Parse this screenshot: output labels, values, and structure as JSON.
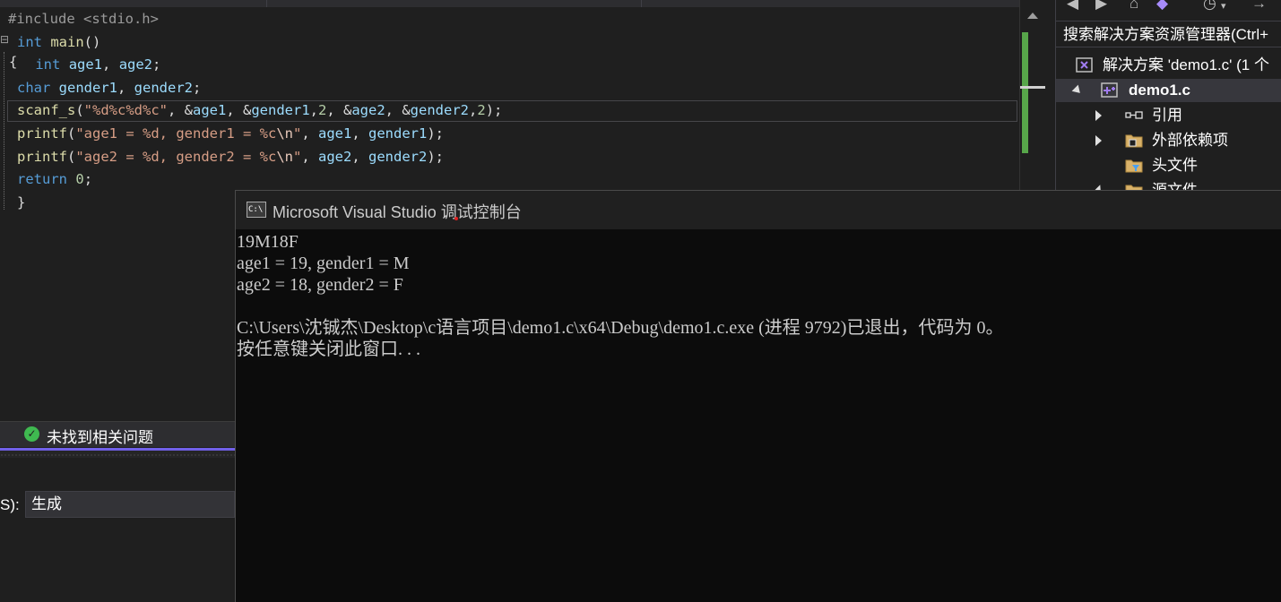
{
  "editor": {
    "lines": [
      {
        "tokens": [
          {
            "c": "pp",
            "t": "#include <stdio.h>"
          }
        ]
      },
      {
        "tokens": [
          {
            "c": "kw",
            "t": "int"
          },
          {
            "c": "plain",
            "t": " "
          },
          {
            "c": "fn",
            "t": "main"
          },
          {
            "c": "plain",
            "t": "()"
          }
        ]
      },
      {
        "tokens": [
          {
            "c": "plain",
            "t": " "
          },
          {
            "c": "kw",
            "t": "int"
          },
          {
            "c": "plain",
            "t": " "
          },
          {
            "c": "var",
            "t": "age1"
          },
          {
            "c": "plain",
            "t": ", "
          },
          {
            "c": "var",
            "t": "age2"
          },
          {
            "c": "plain",
            "t": ";"
          }
        ]
      },
      {
        "tokens": [
          {
            "c": "kw",
            "t": "char"
          },
          {
            "c": "plain",
            "t": " "
          },
          {
            "c": "var",
            "t": "gender1"
          },
          {
            "c": "plain",
            "t": ", "
          },
          {
            "c": "var",
            "t": "gender2"
          },
          {
            "c": "plain",
            "t": ";"
          }
        ]
      },
      {
        "tokens": [
          {
            "c": "fn",
            "t": "scanf_s"
          },
          {
            "c": "plain",
            "t": "("
          },
          {
            "c": "str",
            "t": "\"%d%c%d%c\""
          },
          {
            "c": "plain",
            "t": ", &"
          },
          {
            "c": "var",
            "t": "age1"
          },
          {
            "c": "plain",
            "t": ", &"
          },
          {
            "c": "var",
            "t": "gender1"
          },
          {
            "c": "plain",
            "t": ","
          },
          {
            "c": "num",
            "t": "2"
          },
          {
            "c": "plain",
            "t": ", &"
          },
          {
            "c": "var",
            "t": "age2"
          },
          {
            "c": "plain",
            "t": ", &"
          },
          {
            "c": "var",
            "t": "gender2"
          },
          {
            "c": "plain",
            "t": ","
          },
          {
            "c": "num",
            "t": "2"
          },
          {
            "c": "plain",
            "t": ");"
          }
        ]
      },
      {
        "tokens": [
          {
            "c": "fn",
            "t": "printf"
          },
          {
            "c": "plain",
            "t": "("
          },
          {
            "c": "str",
            "t": "\"age1 = %d, gender1 = %c"
          },
          {
            "c": "esc",
            "t": "\\n"
          },
          {
            "c": "str",
            "t": "\""
          },
          {
            "c": "plain",
            "t": ", "
          },
          {
            "c": "var",
            "t": "age1"
          },
          {
            "c": "plain",
            "t": ", "
          },
          {
            "c": "var",
            "t": "gender1"
          },
          {
            "c": "plain",
            "t": ");"
          }
        ]
      },
      {
        "tokens": [
          {
            "c": "fn",
            "t": "printf"
          },
          {
            "c": "plain",
            "t": "("
          },
          {
            "c": "str",
            "t": "\"age2 = %d, gender2 = %c"
          },
          {
            "c": "esc",
            "t": "\\n"
          },
          {
            "c": "str",
            "t": "\""
          },
          {
            "c": "plain",
            "t": ", "
          },
          {
            "c": "var",
            "t": "age2"
          },
          {
            "c": "plain",
            "t": ", "
          },
          {
            "c": "var",
            "t": "gender2"
          },
          {
            "c": "plain",
            "t": ");"
          }
        ]
      },
      {
        "tokens": [
          {
            "c": "kw",
            "t": "return"
          },
          {
            "c": "plain",
            "t": " "
          },
          {
            "c": "num",
            "t": "0"
          },
          {
            "c": "plain",
            "t": ";"
          }
        ]
      },
      {
        "tokens": [
          {
            "c": "plain",
            "t": "}"
          }
        ]
      }
    ],
    "open_brace": "{",
    "fold_marker": "⊟"
  },
  "solution_explorer": {
    "search_label": "搜索解决方案资源管理器(Ctrl+",
    "solution_label": "解决方案 'demo1.c' (1 个",
    "project_label": "demo1.c",
    "items": [
      {
        "label": "引用",
        "icon": "reference-icon",
        "expandable": true
      },
      {
        "label": "外部依赖项",
        "icon": "external-dependencies-icon",
        "expandable": true
      },
      {
        "label": "头文件",
        "icon": "header-files-filter-icon",
        "expandable": false
      },
      {
        "label": "源文件",
        "icon": "source-files-filter-icon",
        "expandable": true
      }
    ]
  },
  "error_list": {
    "status": "未找到相关问题"
  },
  "output_panel": {
    "source_label": "S):",
    "source_value": "生成"
  },
  "console": {
    "title": "Microsoft Visual Studio 调试控制台",
    "output": "19M18F\nage1 = 19, gender1 = M\nage2 = 18, gender2 = F\n\nC:\\Users\\沈铖杰\\Desktop\\c语言项目\\demo1.c\\x64\\Debug\\demo1.c.exe (进程 9792)已退出，代码为 0。\n按任意键关闭此窗口. . ."
  },
  "colors": {
    "keyword": "#569cd6",
    "string": "#d69d85",
    "function": "#dcdcaa",
    "variable": "#9cdcfe",
    "number": "#b5cea8",
    "accent": "#7160e8",
    "success": "#3fb950"
  }
}
